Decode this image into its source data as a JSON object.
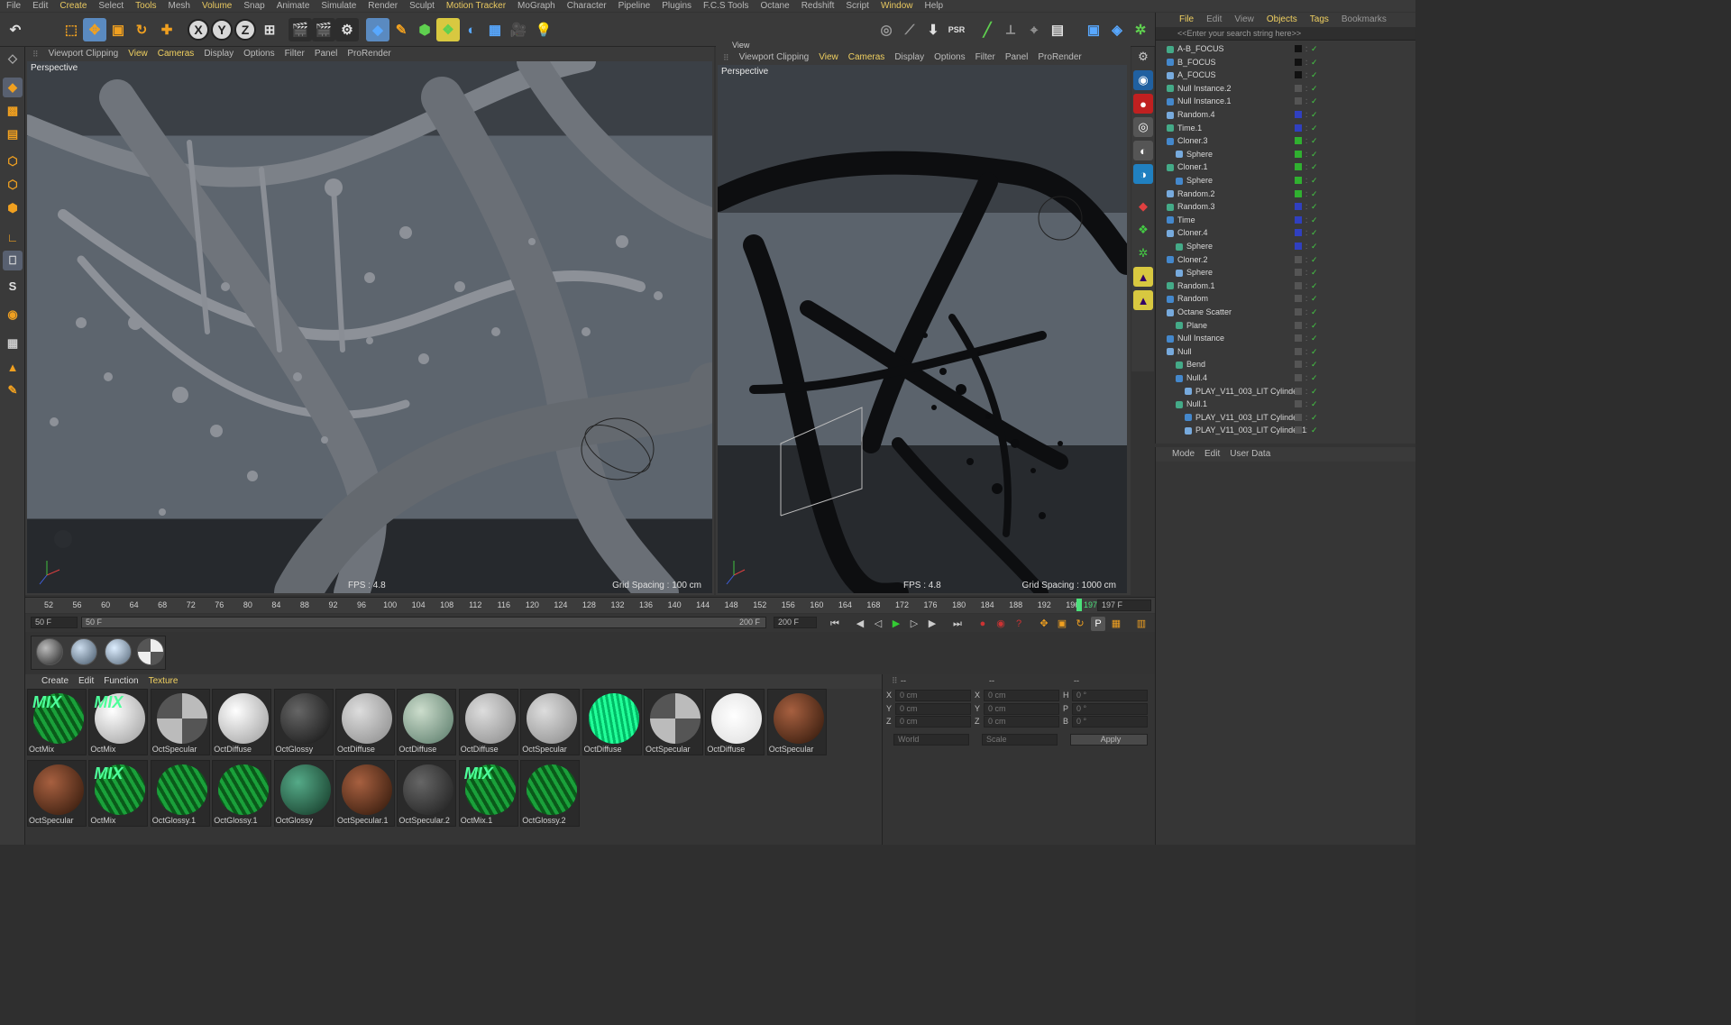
{
  "menubar": [
    "File",
    "Edit",
    "Create",
    "Select",
    "Tools",
    "Mesh",
    "Volume",
    "Snap",
    "Animate",
    "Simulate",
    "Render",
    "Sculpt",
    "Motion Tracker",
    "MoGraph",
    "Character",
    "Pipeline",
    "Plugins",
    "F.C.S Tools",
    "Octane",
    "Redshift",
    "Script",
    "Window",
    "Help"
  ],
  "menubar_highlight": [
    "Create",
    "Tools",
    "Volume",
    "Motion Tracker",
    "Window"
  ],
  "viewport_left": {
    "menu": [
      "Viewport Clipping",
      "View",
      "Cameras",
      "Display",
      "Options",
      "Filter",
      "Panel",
      "ProRender"
    ],
    "label": "Perspective",
    "fps": "FPS : 4.8",
    "grid": "Grid Spacing : 100 cm"
  },
  "viewport_right": {
    "title": "View",
    "menu": [
      "Viewport Clipping",
      "View",
      "Cameras",
      "Display",
      "Options",
      "Filter",
      "Panel",
      "ProRender"
    ],
    "label": "Perspective",
    "fps": "FPS : 4.8",
    "grid": "Grid Spacing : 1000 cm"
  },
  "object_manager": {
    "menu": [
      "File",
      "Edit",
      "View",
      "Objects",
      "Tags",
      "Bookmarks"
    ],
    "search_placeholder": "<<Enter your search string here>>",
    "objects": [
      {
        "name": "A-B_FOCUS",
        "indent": 0,
        "color": "#111111"
      },
      {
        "name": "B_FOCUS",
        "indent": 0,
        "color": "#111111"
      },
      {
        "name": "A_FOCUS",
        "indent": 0,
        "color": "#111111"
      },
      {
        "name": "Null Instance.2",
        "indent": 0,
        "color": "#555555"
      },
      {
        "name": "Null Instance.1",
        "indent": 0,
        "color": "#555555"
      },
      {
        "name": "Random.4",
        "indent": 0,
        "color": "#3040c0"
      },
      {
        "name": "Time.1",
        "indent": 0,
        "color": "#3040c0"
      },
      {
        "name": "Cloner.3",
        "indent": 0,
        "color": "#30b030"
      },
      {
        "name": "Sphere",
        "indent": 1,
        "color": "#30b030"
      },
      {
        "name": "Cloner.1",
        "indent": 0,
        "color": "#30b030"
      },
      {
        "name": "Sphere",
        "indent": 1,
        "color": "#30b030"
      },
      {
        "name": "Random.2",
        "indent": 0,
        "color": "#30b030"
      },
      {
        "name": "Random.3",
        "indent": 0,
        "color": "#3040c0"
      },
      {
        "name": "Time",
        "indent": 0,
        "color": "#3040c0"
      },
      {
        "name": "Cloner.4",
        "indent": 0,
        "color": "#3040c0"
      },
      {
        "name": "Sphere",
        "indent": 1,
        "color": "#3040c0"
      },
      {
        "name": "Cloner.2",
        "indent": 0,
        "color": "#555555"
      },
      {
        "name": "Sphere",
        "indent": 1,
        "color": "#555555"
      },
      {
        "name": "Random.1",
        "indent": 0,
        "color": "#555555"
      },
      {
        "name": "Random",
        "indent": 0,
        "color": "#555555"
      },
      {
        "name": "Octane Scatter",
        "indent": 0,
        "color": "#555555"
      },
      {
        "name": "Plane",
        "indent": 1,
        "color": "#555555"
      },
      {
        "name": "Null Instance",
        "indent": 0,
        "color": "#555555"
      },
      {
        "name": "Null",
        "indent": 0,
        "color": "#555555"
      },
      {
        "name": "Bend",
        "indent": 1,
        "color": "#555555"
      },
      {
        "name": "Null.4",
        "indent": 1,
        "color": "#555555"
      },
      {
        "name": "PLAY_V11_003_LIT Cylinder",
        "indent": 2,
        "color": "#555555"
      },
      {
        "name": "Null.1",
        "indent": 1,
        "color": "#555555"
      },
      {
        "name": "PLAY_V11_003_LIT Cylinder",
        "indent": 2,
        "color": "#555555"
      },
      {
        "name": "PLAY_V11_003_LIT Cylinder.1",
        "indent": 2,
        "color": "#555555"
      }
    ]
  },
  "attribute_manager": {
    "menu": [
      "Mode",
      "Edit",
      "User Data"
    ]
  },
  "timeline": {
    "ticks": [
      "52",
      "56",
      "60",
      "64",
      "68",
      "72",
      "76",
      "80",
      "84",
      "88",
      "92",
      "96",
      "100",
      "104",
      "108",
      "112",
      "116",
      "120",
      "124",
      "128",
      "132",
      "136",
      "140",
      "144",
      "148",
      "152",
      "156",
      "160",
      "164",
      "168",
      "172",
      "176",
      "180",
      "184",
      "188",
      "192",
      "196"
    ],
    "current_marker": "197",
    "current_frame_field": "197 F"
  },
  "range": {
    "start_field": "50 F",
    "range_start": "50 F",
    "range_end": "200 F",
    "end_field": "200 F"
  },
  "material_manager": {
    "menu": [
      "Create",
      "Edit",
      "Function",
      "Texture"
    ],
    "materials": [
      {
        "name": "OctMix",
        "style": "green",
        "mix": "MIX"
      },
      {
        "name": "OctMix",
        "style": "white",
        "mix": "MIX"
      },
      {
        "name": "OctSpecular",
        "style": "check"
      },
      {
        "name": "OctDiffuse",
        "style": "white"
      },
      {
        "name": "OctGlossy",
        "style": "black"
      },
      {
        "name": "OctDiffuse",
        "style": "glass"
      },
      {
        "name": "OctDiffuse",
        "style": "glassgreen"
      },
      {
        "name": "OctDiffuse",
        "style": "glass"
      },
      {
        "name": "OctSpecular",
        "style": "glass"
      },
      {
        "name": "OctDiffuse",
        "style": "brightgreen"
      },
      {
        "name": "OctSpecular",
        "style": "check"
      },
      {
        "name": "OctDiffuse",
        "style": "whitebright"
      },
      {
        "name": "OctSpecular",
        "style": "brown"
      },
      {
        "name": "OctSpecular",
        "style": "brown"
      },
      {
        "name": "OctMix",
        "style": "green",
        "mix": "MIX"
      },
      {
        "name": "OctGlossy.1",
        "style": "green"
      },
      {
        "name": "OctGlossy.1",
        "style": "green"
      },
      {
        "name": "OctGlossy",
        "style": "darkgreen"
      },
      {
        "name": "OctSpecular.1",
        "style": "brown"
      },
      {
        "name": "OctSpecular.2",
        "style": "darkgrey"
      },
      {
        "name": "OctMix.1",
        "style": "green",
        "mix": "MIX"
      },
      {
        "name": "OctGlossy.2",
        "style": "green"
      }
    ]
  },
  "coordinates": {
    "header": [
      "--",
      "--",
      "--"
    ],
    "rows": [
      {
        "a": "X",
        "av": "0 cm",
        "b": "X",
        "bv": "0 cm",
        "c": "H",
        "cv": "0 °"
      },
      {
        "a": "Y",
        "av": "0 cm",
        "b": "Y",
        "bv": "0 cm",
        "c": "P",
        "cv": "0 °"
      },
      {
        "a": "Z",
        "av": "0 cm",
        "b": "Z",
        "bv": "0 cm",
        "c": "B",
        "cv": "0 °"
      }
    ],
    "mode": "World",
    "scale": "Scale",
    "apply": "Apply"
  }
}
